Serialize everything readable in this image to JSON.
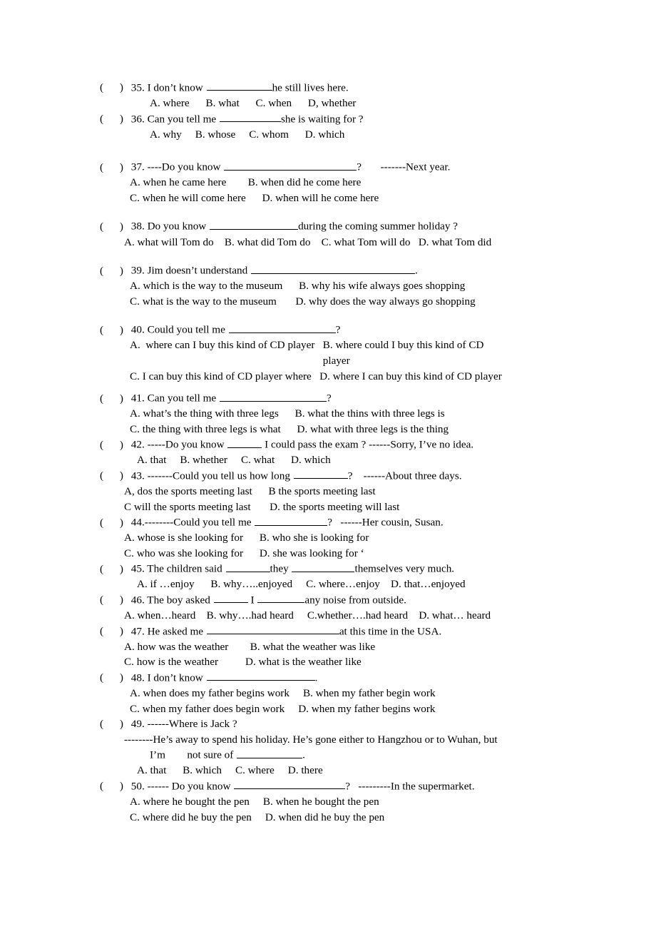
{
  "document": {
    "type": "english-grammar-worksheet",
    "topic": "noun clauses / indirect questions",
    "page_background": "#ffffff",
    "text_color": "#000000"
  },
  "questions": [
    {
      "number": "35",
      "bracket": "(",
      "bracket_close": ")",
      "stem_before": "35. I don’t know",
      "stem_after": "he still lives here.",
      "blank_width": 92,
      "option_rows": [
        {
          "cells": [
            "A. where",
            "B. what",
            "C. when",
            "D, whether"
          ]
        }
      ]
    },
    {
      "number": "36",
      "bracket": "(",
      "bracket_close": ")",
      "stem_before": "36. Can you tell me",
      "stem_after": "she is waiting for ?",
      "blank_width": 86,
      "option_rows": [
        {
          "cells": [
            "A. why",
            "B. whose",
            "C. whom",
            "D. which"
          ]
        }
      ]
    },
    {
      "number": "37",
      "bracket": "(",
      "bracket_close": ")",
      "stem_before": "37. ----Do you know",
      "stem_after": "?       -------Next year.",
      "blank_width": 186,
      "option_rows": [
        {
          "cells": [
            "A. when he came here",
            "B. when did he come here"
          ]
        },
        {
          "cells": [
            "C. when he will come here",
            "D. when will he come here"
          ]
        }
      ]
    },
    {
      "number": "38",
      "bracket": "(",
      "bracket_close": ")",
      "stem_before": "38. Do you know",
      "stem_after": "during the coming summer holiday ?",
      "blank_width": 124,
      "option_rows": [
        {
          "cells": [
            "A. what will Tom do",
            "B. what did Tom do",
            "C. what Tom will do",
            "D. what Tom did"
          ]
        }
      ]
    },
    {
      "number": "39",
      "bracket": "(",
      "bracket_close": ")",
      "stem_before": "39. Jim doesn’t understand",
      "stem_after": ".",
      "blank_width": 230,
      "option_rows": [
        {
          "cells": [
            "A. which is the way to the museum",
            "B. why his wife always goes shopping"
          ]
        },
        {
          "cells": [
            "C. what is the way to the museum",
            "D. why does the way always go shopping"
          ]
        }
      ]
    },
    {
      "number": "40",
      "bracket": "(",
      "bracket_close": ")",
      "stem_before": "40. Could you tell me",
      "stem_after": "?",
      "blank_width": 150,
      "option_rows": [
        {
          "cells": [
            "A.  where can I buy this kind of CD player",
            "B. where could I buy this kind of CD player"
          ]
        },
        {
          "cells": [
            "C. I can buy this kind of CD player where",
            "D. where I can buy this kind of CD player"
          ]
        }
      ]
    },
    {
      "number": "41",
      "bracket": "(",
      "bracket_close": ")",
      "stem_before": "41. Can you tell me",
      "stem_after": "?",
      "blank_width": 150,
      "option_rows": [
        {
          "cells": [
            "A. what’s the thing with three legs",
            "B. what the thins with three legs is"
          ]
        },
        {
          "cells": [
            "C. the thing with three legs is what",
            "D. what with three legs is the thing"
          ]
        }
      ]
    },
    {
      "number": "42",
      "bracket": "(",
      "bracket_close": ")",
      "stem_before": "42. -----Do you know",
      "stem_after": "I could pass the exam ? ------Sorry, I’ve no idea.",
      "blank_width": 48,
      "option_rows": [
        {
          "cells": [
            "A. that",
            "B. whether",
            "C. what",
            "D. which"
          ]
        }
      ]
    },
    {
      "number": "43",
      "bracket": "(",
      "bracket_close": ")",
      "stem_before": "43. -------Could you tell us how long",
      "stem_after": "?    ------About three days.",
      "blank_width": 76,
      "option_rows": [
        {
          "cells": [
            "A, dos the sports meeting last",
            "B the sports meeting last"
          ]
        },
        {
          "cells": [
            "C will the sports meeting last",
            "D. the sports meeting will last"
          ]
        }
      ]
    },
    {
      "number": "44",
      "bracket": "(",
      "bracket_close": ")",
      "stem_before": "44.--------Could you tell me",
      "stem_after": "?   ------Her cousin, Susan.",
      "blank_width": 102,
      "option_rows": [
        {
          "cells": [
            "A. whose is she looking for",
            "B. who she is looking for"
          ]
        },
        {
          "cells": [
            "C. who was she looking for",
            "D. she was looking for ‘"
          ]
        }
      ]
    },
    {
      "number": "45",
      "bracket": "(",
      "bracket_close": ")",
      "stem_before": "45. The children said",
      "stem_middle": "they",
      "stem_after": "themselves very much.",
      "blank_width": 62,
      "blank_width_2": 88,
      "option_rows": [
        {
          "cells": [
            "A. if …enjoy",
            "B. why…..enjoyed",
            "C. where…enjoy",
            "D. that…enjoyed"
          ]
        }
      ]
    },
    {
      "number": "46",
      "bracket": "(",
      "bracket_close": ")",
      "stem_before": "46. The boy asked",
      "stem_middle": "I",
      "stem_after": "any noise from outside.",
      "blank_width": 48,
      "blank_width_2": 66,
      "option_rows": [
        {
          "cells": [
            "A. when…heard",
            "B. why….had heard",
            "C.whether….had heard",
            "D. what… heard"
          ]
        }
      ]
    },
    {
      "number": "47",
      "bracket": "(",
      "bracket_close": ")",
      "stem_before": "47. He asked me",
      "stem_after": "at this time in the USA.",
      "blank_width": 186,
      "option_rows": [
        {
          "cells": [
            "A. how was the weather",
            "B. what the weather was like"
          ]
        },
        {
          "cells": [
            "C. how is the weather",
            "D. what is the weather like"
          ]
        }
      ]
    },
    {
      "number": "48",
      "bracket": "(",
      "bracket_close": ")",
      "stem_before": "48. I don’t know",
      "stem_after": ".",
      "blank_width": 152,
      "option_rows": [
        {
          "cells": [
            "A. when does my father begins work",
            "B. when my father begin work"
          ]
        },
        {
          "cells": [
            "C. when my father does begin work",
            "D. when my father begins work"
          ]
        }
      ]
    },
    {
      "number": "49",
      "bracket": "(",
      "bracket_close": ")",
      "stem_before": "49. ------Where is Jack ?",
      "dialogue_line_1": "--------He’s away to spend his holiday. He’s gone either to Hangzhou or to Wuhan, but",
      "dialogue_line_2_a": "I’m",
      "dialogue_line_2_b": "not sure of",
      "dialogue_line_2_c": ".",
      "blank_width": 92,
      "option_rows": [
        {
          "cells": [
            "A. that",
            "B. which",
            "C. where",
            "D. there"
          ]
        }
      ]
    },
    {
      "number": "50",
      "bracket": "(",
      "bracket_close": ")",
      "stem_before": "50. ------ Do you know",
      "stem_after": "?   ---------In the supermarket.",
      "blank_width": 156,
      "option_rows": [
        {
          "cells": [
            "A. where he bought the pen",
            "B. when he bought the pen"
          ]
        },
        {
          "cells": [
            "C. where did he buy the pen",
            "D. when did he buy the pen"
          ]
        }
      ]
    }
  ]
}
